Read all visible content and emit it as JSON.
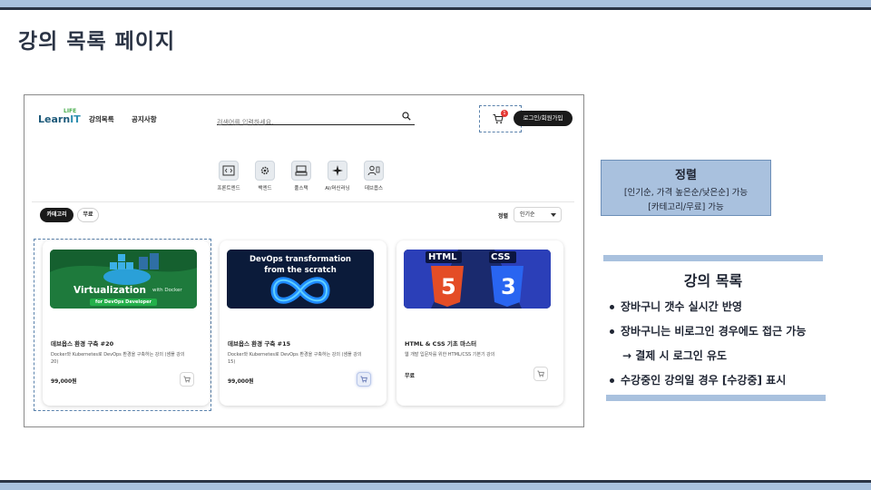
{
  "slide": {
    "title": "강의 목록 페이지"
  },
  "app": {
    "logo_prefix": "Learn",
    "logo_suffix": "IT",
    "logo_tag": "LIFE",
    "nav": [
      "강의목록",
      "공지사항"
    ],
    "search_placeholder": "검색어를 입력하세요.",
    "cart_count": "1",
    "login_label": "로그인/회원가입",
    "categories": [
      "프론트엔드",
      "백엔드",
      "풀스택",
      "AI/머신러닝",
      "데브옵스"
    ],
    "filters": [
      "카테고리",
      "무료"
    ],
    "sort_label": "정렬",
    "sort_value": "인기순",
    "courses": [
      {
        "thumb_title": "Virtualization",
        "thumb_sub": "with Docker",
        "thumb_tag": "for DevOps Developer",
        "title": "데브옵스 환경 구축 #20",
        "desc": "Docker와 Kubernetes로 DevOps 환경을 구축하는 강의 (샘플 강의 20)",
        "price": "99,000원"
      },
      {
        "thumb_title": "DevOps transformation",
        "thumb_sub": "from the scratch",
        "title": "데브옵스 환경 구축 #15",
        "desc": "Docker와 Kubernetes로 DevOps 환경을 구축하는 강의 (샘플 강의 15)",
        "price": "99,000원"
      },
      {
        "thumb_left": "HTML",
        "thumb_right": "CSS",
        "thumb_left_num": "5",
        "thumb_right_num": "3",
        "title": "HTML & CSS 기초 마스터",
        "desc": "웹 개발 입문자를 위한 HTML/CSS 기본기 강의",
        "price": "무료"
      }
    ]
  },
  "annotations": {
    "sort_box": {
      "title": "정렬",
      "line1": "[인기순, 가격 높은순/낮은순] 가능",
      "line2": "[카테고리/무료] 가능"
    },
    "list": {
      "title": "강의 목록",
      "bullets": [
        "장바구니 갯수 실시간 반영",
        "장바구니는 비로그인 경우에도 접근 가능",
        "수강중인 강의일 경우 [수강중] 표시"
      ],
      "arrow_note": "→ 결제 시 로그인 유도"
    }
  },
  "colors": {
    "accent_blue": "#a9c1de",
    "dark": "#2b3445",
    "thumb_green": "#1e7a3c",
    "thumb_navy": "#0b1b3a",
    "html_orange": "#e44d26",
    "css_blue": "#2965f1"
  }
}
